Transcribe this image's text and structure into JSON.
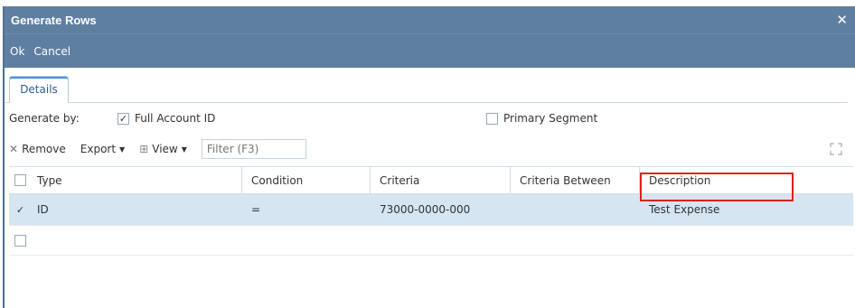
{
  "dialog": {
    "title": "Generate Rows",
    "close_glyph": "✕",
    "toolbar": {
      "ok_label": "Ok",
      "cancel_label": "Cancel"
    }
  },
  "tabs": [
    {
      "label": "Details",
      "active": true
    }
  ],
  "generate_by": {
    "label": "Generate by:",
    "full_account_id": {
      "label": "Full Account ID",
      "checked": true
    },
    "primary_segment": {
      "label": "Primary Segment",
      "checked": false
    }
  },
  "grid_toolbar": {
    "remove_label": "Remove",
    "export_label": "Export",
    "view_label": "View",
    "filter_placeholder": "Filter (F3)"
  },
  "grid": {
    "columns": [
      "Type",
      "Condition",
      "Criteria",
      "Criteria Between",
      "Description"
    ],
    "rows": [
      {
        "selected": true,
        "checked": true,
        "type": "ID",
        "condition": "=",
        "criteria": "73000-0000-000",
        "criteria_between": "",
        "description": "Test Expense"
      }
    ]
  },
  "icons": {
    "remove": "x-icon",
    "view": "grid-icon",
    "expand": "expand-icon",
    "dropdown": "caret-down-icon"
  },
  "colors": {
    "titlebar": "#5f7fa1",
    "selected_row": "#d5e5f2",
    "highlight": "#e02020",
    "tab_text": "#2a5d96"
  }
}
